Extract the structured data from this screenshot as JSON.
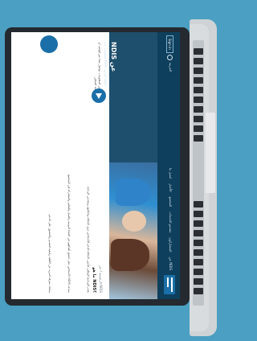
{
  "site": {
    "language_label": "العربية",
    "signin_label": "Sign in",
    "nav": [
      "عن NDIS",
      "المشاركون",
      "مقدمو الخدمات",
      "المجتمع",
      "الأخبار",
      "اتصل بنا"
    ],
    "hero_title": "NDIS عن",
    "hero_subtitle": "معلومات عن NDIS باللغة العربية",
    "breadcrumb": "الرئيسية / عن NDIS",
    "content_title": "ما هو NDIS؟",
    "paragraphs": [
      "يقدم البرنامج الوطني لتأمين الإعاقة الدعم للأشخاص ذوي الإعاقة وعائلاتهم ومقدمي الرعاية.",
      "يساعد NDIS الأشخاص على تحقيق أهدافهم في الحياة اليومية والعمل والتعليم والمشاركة في المجتمع.",
      "يمكنك معرفة المزيد عن الأهلية وكيفية التقديم والحصول على الدعم."
    ],
    "sidebar_text": "لمزيد من المعلومات تواصل معنا عبر الهاتف أو زر مكتبنا المحلي."
  }
}
